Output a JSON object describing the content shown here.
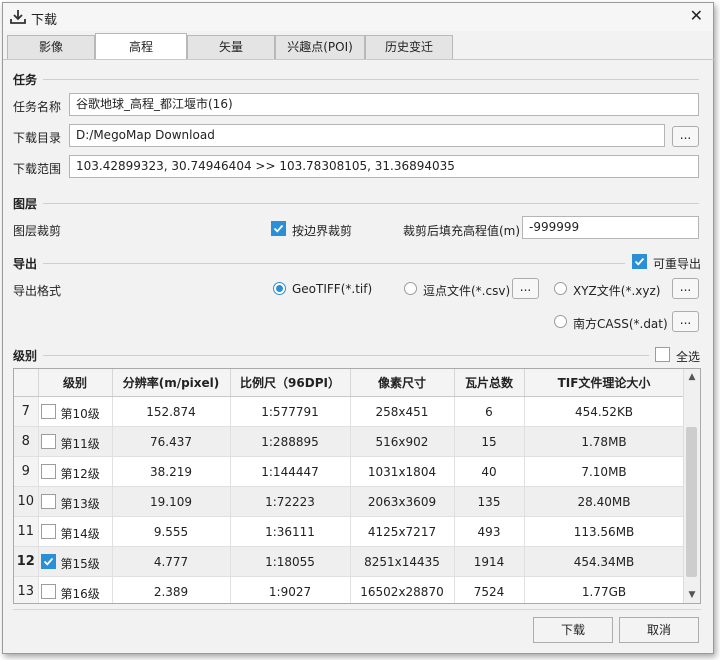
{
  "window": {
    "title": "下载",
    "icon": "download-icon",
    "close": "✕"
  },
  "tabs": [
    {
      "label": "影像"
    },
    {
      "label": "高程",
      "active": true
    },
    {
      "label": "矢量"
    },
    {
      "label": "兴趣点(POI)"
    },
    {
      "label": "历史变迁"
    }
  ],
  "task": {
    "section_title": "任务",
    "name_label": "任务名称",
    "name_value": "谷歌地球_高程_都江堰市(16)",
    "dir_label": "下载目录",
    "dir_value": "D:/MegoMap Download",
    "dir_button": "...",
    "range_label": "下载范围",
    "range_value": "103.42899323, 30.74946404 >> 103.78308105, 31.36894035"
  },
  "layer": {
    "section_title": "图层",
    "clip_label": "图层裁剪",
    "clip_checkbox_label": "按边界裁剪",
    "clip_checked": true,
    "fill_label": "裁剪后填充高程值(m)",
    "fill_value": "-999999"
  },
  "export": {
    "section_title": "导出",
    "reexport_label": "可重导出",
    "reexport_checked": true,
    "format_label": "导出格式",
    "options": [
      {
        "label": "GeoTIFF(*.tif)",
        "selected": true
      },
      {
        "label": "逗点文件(*.csv)",
        "selected": false
      },
      {
        "label": "XYZ文件(*.xyz)",
        "selected": false
      },
      {
        "label": "南方CASS(*.dat)",
        "selected": false
      }
    ],
    "option_button": "..."
  },
  "levels": {
    "section_title": "级别",
    "select_all_label": "全选",
    "select_all_checked": false,
    "columns": [
      "",
      "级别",
      "分辨率(m/pixel)",
      "比例尺（96DPI）",
      "像素尺寸",
      "瓦片总数",
      "TIF文件理论大小"
    ],
    "rows": [
      {
        "num": "7",
        "level": "第10级",
        "res": "152.874",
        "scale": "1:577791",
        "pixels": "258x451",
        "tiles": "6",
        "size": "454.52KB",
        "checked": false
      },
      {
        "num": "8",
        "level": "第11级",
        "res": "76.437",
        "scale": "1:288895",
        "pixels": "516x902",
        "tiles": "15",
        "size": "1.78MB",
        "checked": false
      },
      {
        "num": "9",
        "level": "第12级",
        "res": "38.219",
        "scale": "1:144447",
        "pixels": "1031x1804",
        "tiles": "40",
        "size": "7.10MB",
        "checked": false
      },
      {
        "num": "10",
        "level": "第13级",
        "res": "19.109",
        "scale": "1:72223",
        "pixels": "2063x3609",
        "tiles": "135",
        "size": "28.40MB",
        "checked": false
      },
      {
        "num": "11",
        "level": "第14级",
        "res": "9.555",
        "scale": "1:36111",
        "pixels": "4125x7217",
        "tiles": "493",
        "size": "113.56MB",
        "checked": false
      },
      {
        "num": "12",
        "level": "第15级",
        "res": "4.777",
        "scale": "1:18055",
        "pixels": "8251x14435",
        "tiles": "1914",
        "size": "454.34MB",
        "checked": true
      },
      {
        "num": "13",
        "level": "第16级",
        "res": "2.389",
        "scale": "1:9027",
        "pixels": "16502x28870",
        "tiles": "7524",
        "size": "1.77GB",
        "checked": false
      }
    ]
  },
  "footer": {
    "download_button": "下载",
    "cancel_button": "取消"
  },
  "colors": {
    "accent": "#2b8fd6"
  }
}
